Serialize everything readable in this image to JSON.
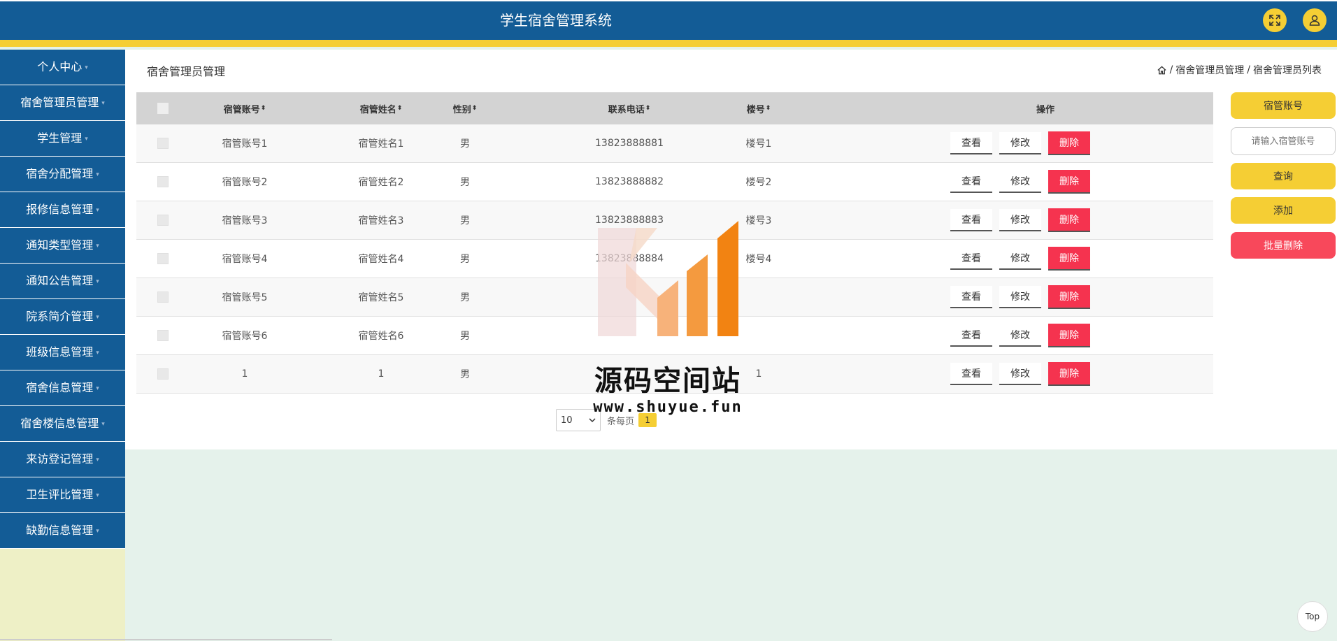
{
  "header": {
    "title": "学生宿舍管理系统",
    "fullscreen_icon": "expand-icon",
    "user_icon": "user-icon"
  },
  "sidebar": {
    "items": [
      {
        "label": "个人中心"
      },
      {
        "label": "宿舍管理员管理"
      },
      {
        "label": "学生管理"
      },
      {
        "label": "宿舍分配管理"
      },
      {
        "label": "报修信息管理"
      },
      {
        "label": "通知类型管理"
      },
      {
        "label": "通知公告管理"
      },
      {
        "label": "院系简介管理"
      },
      {
        "label": "班级信息管理"
      },
      {
        "label": "宿舍信息管理"
      },
      {
        "label": "宿舍楼信息管理"
      },
      {
        "label": "来访登记管理"
      },
      {
        "label": "卫生评比管理"
      },
      {
        "label": "缺勤信息管理"
      }
    ]
  },
  "main": {
    "heading": "宿舍管理员管理",
    "breadcrumb": [
      "宿舍管理员管理",
      "宿舍管理员列表"
    ],
    "breadcrumb_sep": "/"
  },
  "table": {
    "columns": {
      "account": "宿管账号",
      "name": "宿管姓名",
      "gender": "性别",
      "phone": "联系电话",
      "building": "楼号",
      "actions": "操作"
    },
    "sort_glyph": "⬍",
    "rows": [
      {
        "account": "宿管账号1",
        "name": "宿管姓名1",
        "gender": "男",
        "phone": "13823888881",
        "building": "楼号1"
      },
      {
        "account": "宿管账号2",
        "name": "宿管姓名2",
        "gender": "男",
        "phone": "13823888882",
        "building": "楼号2"
      },
      {
        "account": "宿管账号3",
        "name": "宿管姓名3",
        "gender": "男",
        "phone": "13823888883",
        "building": "楼号3"
      },
      {
        "account": "宿管账号4",
        "name": "宿管姓名4",
        "gender": "男",
        "phone": "13823888884",
        "building": "楼号4"
      },
      {
        "account": "宿管账号5",
        "name": "宿管姓名5",
        "gender": "男",
        "phone": "",
        "building": ""
      },
      {
        "account": "宿管账号6",
        "name": "宿管姓名6",
        "gender": "男",
        "phone": "",
        "building": ""
      },
      {
        "account": "1",
        "name": "1",
        "gender": "男",
        "phone": "",
        "building": "1"
      }
    ],
    "actions": {
      "view": "查看",
      "edit": "修改",
      "delete": "删除"
    }
  },
  "pagination": {
    "page_size": "10",
    "per_page_label": "条每页",
    "current_page": "1"
  },
  "search_panel": {
    "field_label": "宿管账号",
    "input_placeholder": "请输入宿管账号",
    "query_button": "查询",
    "add_button": "添加",
    "batch_delete_button": "批量删除"
  },
  "top_button": "Top",
  "watermark": {
    "title": "源码空间站",
    "url": "www.shuyue.fun"
  },
  "colors": {
    "primary": "#135c96",
    "accent": "#f5ce34",
    "danger": "#f5334f",
    "content_bg": "#e5f2eb"
  }
}
